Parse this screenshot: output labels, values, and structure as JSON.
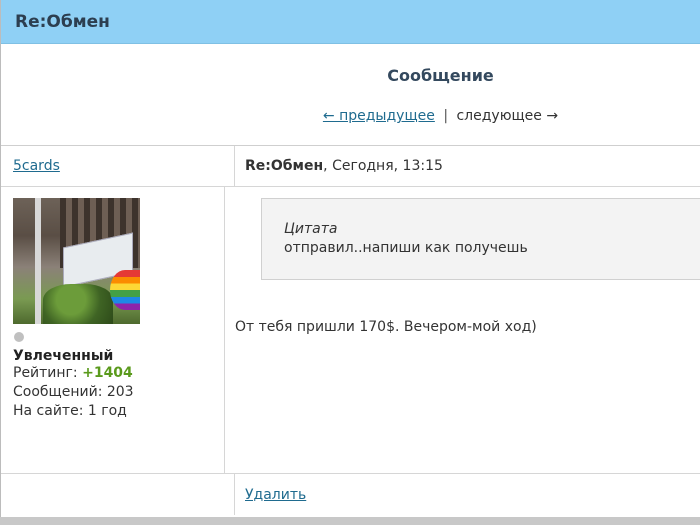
{
  "window": {
    "title": "Re:Обмен"
  },
  "header": {
    "heading": "Сообщение",
    "prev_label": "← предыдущее",
    "separator": "|",
    "next_label": "следующее →"
  },
  "post": {
    "author": "5cards",
    "subject": "Re:Обмен",
    "time": ", Сегодня, 13:15",
    "user": {
      "rank": "Увлеченный",
      "rating_label": "Рейтинг: ",
      "rating_value": "+1404",
      "messages": "Сообщений: 203",
      "on_site": "На сайте: 1 год"
    },
    "quote": {
      "title": "Цитата",
      "text": "отправил..напиши как получешь"
    },
    "message": "От тебя пришли 170$. Вечером-мой ход)",
    "delete_label": "Удалить"
  },
  "colors": {
    "title_bar": "#8fd0f5",
    "link": "#1f6b8f",
    "rating": "#5a9a1c"
  }
}
